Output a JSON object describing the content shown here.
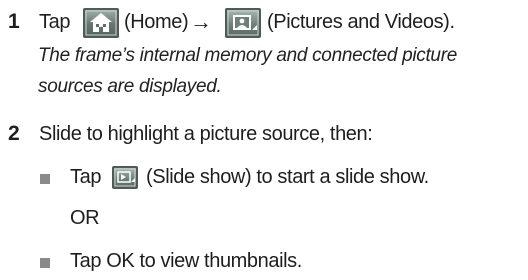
{
  "steps": [
    {
      "number": "1",
      "parts": {
        "tap": "Tap",
        "home_label": "(Home)",
        "arrow": "→",
        "pics_label": "(Pictures and Videos)."
      },
      "note_line1": "The frame’s internal memory and connected picture",
      "note_line2": "sources are displayed."
    },
    {
      "number": "2",
      "text": "Slide to highlight a picture source, then:",
      "options": [
        {
          "tap": "Tap",
          "label": "(Slide show) to start a slide show."
        },
        {
          "text": "Tap OK to view thumbnails."
        }
      ],
      "or_text": "OR"
    }
  ],
  "icons": {
    "home": "home-icon",
    "pictures": "pictures-videos-icon",
    "slideshow": "slide-show-icon"
  }
}
